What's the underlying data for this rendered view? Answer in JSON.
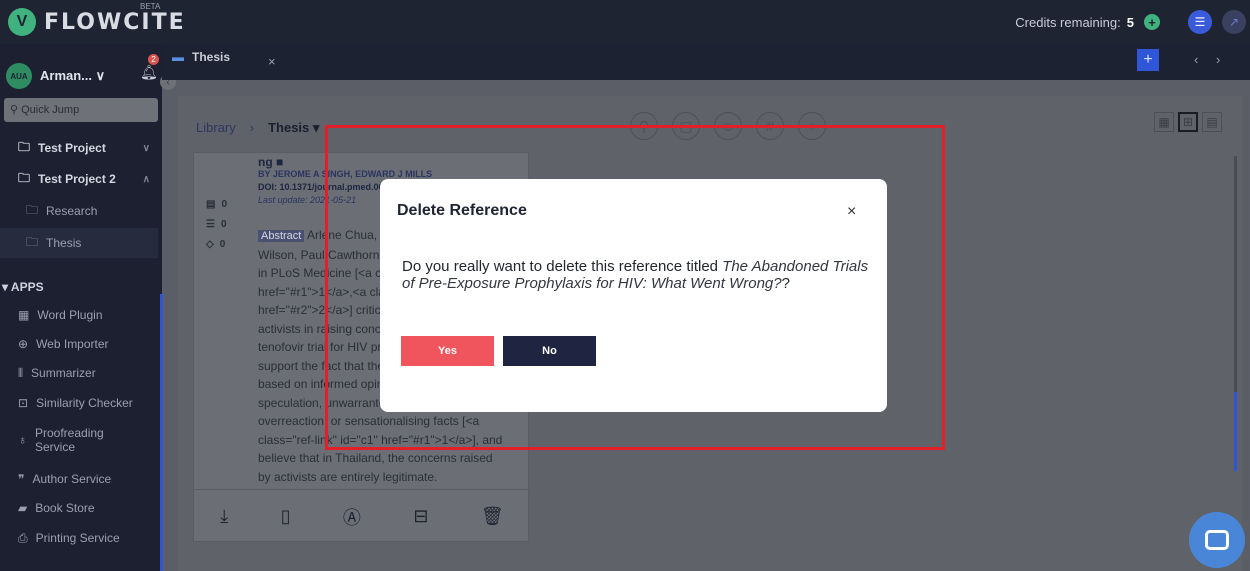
{
  "app": {
    "brand": "FLOWCITE",
    "beta": "BETA",
    "logo_glyph": "V"
  },
  "topbar": {
    "credits_label": "Credits remaining:",
    "credits_value": "5"
  },
  "user": {
    "initials": "AUA",
    "name": "Arman... ∨",
    "notifications": "2"
  },
  "sidebar": {
    "quick_jump_placeholder": "Quick Jump",
    "projects": [
      {
        "label": "Test Project",
        "chevron": "∨"
      },
      {
        "label": "Test Project 2",
        "chevron": "∧"
      }
    ],
    "folders": [
      "Research",
      "Thesis"
    ],
    "apps_title": "▾ APPS",
    "apps": [
      "Word Plugin",
      "Web Importer",
      "Summarizer",
      "Similarity Checker",
      "Proofreading Service",
      "Author Service",
      "Book Store",
      "Printing Service"
    ]
  },
  "tabs": {
    "active": "Thesis",
    "close": "×",
    "add": "+",
    "prev": "‹",
    "next": "›"
  },
  "breadcrumb": {
    "library": "Library",
    "separator": "›",
    "current": "Thesis ▾"
  },
  "reference": {
    "title_fragment": "ng ■",
    "authors": "BY JEROME A SINGH, EDWARD J MILLS",
    "doi": "DOI: 10.1371/journal.pmed.0020234",
    "last_update": "Last update: 2021-05-21",
    "counts": [
      "0",
      "0",
      "0"
    ],
    "abstract_badge": "Abstract",
    "abstract_lines": [
      " Arlene Chua, Edward Mills, Kumanan",
      "Wilson, Paul Cawthorne, and Lila",
      "in PLoS Medicine [<a class=\"ref-link\" id=\"c1\"",
      "href=\"#r1\">1</a>,<a class=\"ref-link\" id=\"c2\"",
      "href=\"#r2\">2</a>] criticise the role of",
      "activists in raising concerns about the",
      "tenofovir trial for HIV prevention. They",
      "support the fact that these concerns were",
      "based on informed opinion rather than",
      "speculation, unwarranted demands,",
      "overreaction, or sensationalising facts [<a",
      "class=\"ref-link\" id=\"c1\" href=\"#r1\">1</a>], and",
      "believe that in Thailand, the concerns raised",
      "by activists are entirely legitimate."
    ]
  },
  "modal": {
    "title": "Delete Reference",
    "close": "×",
    "question_prefix": "Do you really want to delete this reference titled ",
    "reference_title": "The Abandoned Trials of Pre-Exposure Prophylaxis for HIV: What Went Wrong?",
    "question_suffix": "?",
    "yes_label": "Yes",
    "no_label": "No"
  },
  "colors": {
    "accent": "#2f56d8",
    "brand_green": "#3fb27f",
    "danger": "#f0555e",
    "highlight": "#e3202a"
  }
}
